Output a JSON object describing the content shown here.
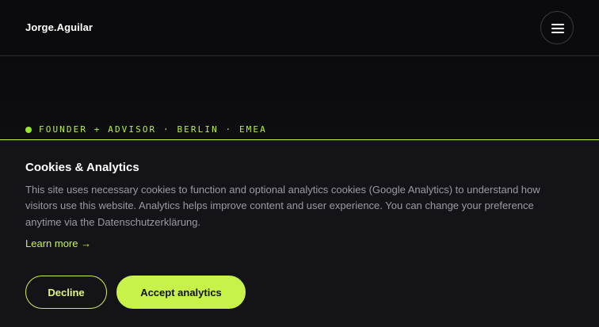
{
  "header": {
    "brand": "Jorge.Aguilar",
    "menu_icon": "hamburger-menu-icon"
  },
  "hero": {
    "eyebrow": "FOUNDER + ADVISOR · BERLIN · EMEA"
  },
  "cookie_banner": {
    "title": "Cookies & Analytics",
    "body": "This site uses necessary cookies to function and optional analytics cookies (Google Analytics) to understand how visitors use this website. Analytics helps improve content and user experience. You can change your preference anytime via the Datenschutzerklärung.",
    "learn_more": "Learn more →",
    "decline_label": "Decline",
    "accept_label": "Accept analytics"
  },
  "colors": {
    "background": "#0b0b0d",
    "panel": "#141418",
    "accent": "#c8f04a",
    "text_muted": "#9a9aa3"
  }
}
